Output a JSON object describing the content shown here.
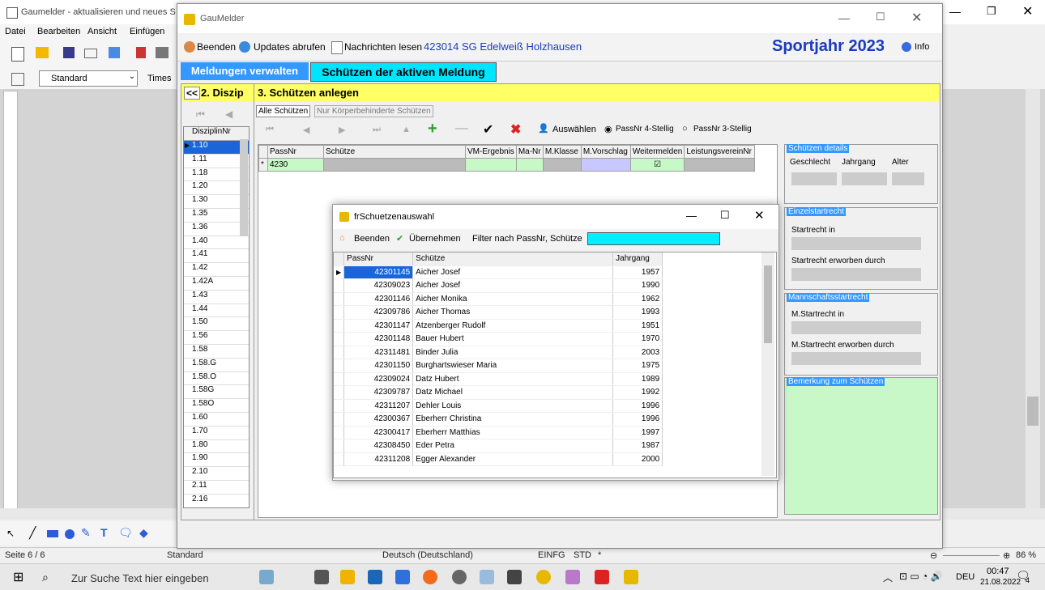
{
  "writer": {
    "title": "Gaumelder - aktualisieren und neues S",
    "menu": [
      "Datei",
      "Bearbeiten",
      "Ansicht",
      "Einfügen"
    ],
    "style_box": "Standard",
    "font_box": "Times",
    "status": {
      "page": "Seite 6 / 6",
      "style": "Standard",
      "language": "Deutsch (Deutschland)",
      "mode": "EINFG",
      "std": "STD",
      "star": "*",
      "zoom": "86 %"
    }
  },
  "app": {
    "title": "GauMelder",
    "toolbar": {
      "beenden": "Beenden",
      "updates": "Updates abrufen",
      "nachrichten": "Nachrichten lesen",
      "verein": "423014  SG Edelweiß Holzhausen",
      "sportjahr": "Sportjahr 2023",
      "info": "Info"
    },
    "tabs": {
      "meldungen": "Meldungen verwalten",
      "schuetzen": "Schützen der aktiven Meldung"
    },
    "left": {
      "header_nav": "<<",
      "header_text": "2. Diszip",
      "column": "DisziplinNr",
      "items": [
        "1.10",
        "1.11",
        "1.18",
        "1.20",
        "1.30",
        "1.35",
        "1.36",
        "1.40",
        "1.41",
        "1.42",
        "1.42A",
        "1.43",
        "1.44",
        "1.50",
        "1.56",
        "1.58",
        "1.58.G",
        "1.58.O",
        "1.58G",
        "1.58O",
        "1.60",
        "1.70",
        "1.80",
        "1.90",
        "2.10",
        "2.11",
        "2.16"
      ]
    },
    "right": {
      "header": "3. Schützen anlegen",
      "subtabs": [
        "Alle Schützen",
        "Nur Körperbehinderte Schützen"
      ],
      "nav_auswaehlen": "Auswählen",
      "radio1": "PassNr 4-Stellig",
      "radio2": "PassNr 3-Stellig",
      "columns": [
        "PassNr",
        "Schütze",
        "VM-Ergebnis",
        "Ma-Nr",
        "M.Klasse",
        "M.Vorschlag",
        "Weitermelden",
        "LeistungsvereinNr"
      ],
      "new_row_passnr": "4230",
      "groups": {
        "details": {
          "title": "Schützen details",
          "labels": [
            "Geschlecht",
            "Jahrgang",
            "Alter"
          ]
        },
        "einzel": {
          "title": "Einzelstartrecht",
          "labels": [
            "Startrecht in",
            "Startrecht erworben durch"
          ]
        },
        "mannschaft": {
          "title": "Mannschaftsstartrecht",
          "labels": [
            "M.Startrecht in",
            "M.Startrecht erworben durch"
          ]
        },
        "bemerkung": {
          "title": "Bemerkung zum Schützen"
        }
      }
    }
  },
  "dialog": {
    "title": "frSchuetzenauswahl",
    "beenden": "Beenden",
    "uebernehmen": "Übernehmen",
    "filter_label": "Filter nach PassNr, Schütze",
    "columns": [
      "PassNr",
      "Schütze",
      "Jahrgang"
    ],
    "rows": [
      [
        "42301145",
        "Aicher Josef",
        "1957"
      ],
      [
        "42309023",
        "Aicher Josef",
        "1990"
      ],
      [
        "42301146",
        "Aicher Monika",
        "1962"
      ],
      [
        "42309786",
        "Aicher Thomas",
        "1993"
      ],
      [
        "42301147",
        "Atzenberger Rudolf",
        "1951"
      ],
      [
        "42301148",
        "Bauer Hubert",
        "1970"
      ],
      [
        "42311481",
        "Binder Julia",
        "2003"
      ],
      [
        "42301150",
        "Burghartswieser Maria",
        "1975"
      ],
      [
        "42309024",
        "Datz Hubert",
        "1989"
      ],
      [
        "42309787",
        "Datz Michael",
        "1992"
      ],
      [
        "42311207",
        "Dehler Louis",
        "1996"
      ],
      [
        "42300367",
        "Eberherr Christina",
        "1996"
      ],
      [
        "42300417",
        "Eberherr Matthias",
        "1997"
      ],
      [
        "42308450",
        "Eder Petra",
        "1987"
      ],
      [
        "42311208",
        "Egger Alexander",
        "2000"
      ]
    ]
  },
  "taskbar": {
    "search_placeholder": "Zur Suche Text hier eingeben",
    "lang": "DEU",
    "time": "00:47",
    "date": "21.08.2022",
    "notif_count": "4"
  }
}
